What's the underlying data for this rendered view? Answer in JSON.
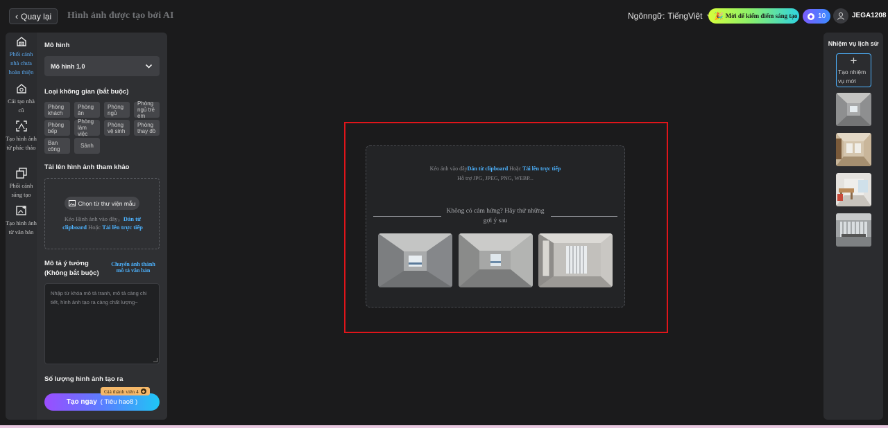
{
  "topbar": {
    "back_label": "Quay lại",
    "app_title": "Hình ảnh được tạo bởi AI",
    "language_label": "Ngônngữ:",
    "language_value": "TiếngViệt",
    "promo_label": "Mời để kiếm điểm sáng tạo",
    "points": "10",
    "username": "JEGA1208"
  },
  "nav": {
    "items": [
      {
        "label": "Phối cảnh nhà chưa hoàn thiện",
        "icon": "house-frame-icon",
        "active": true
      },
      {
        "label": "Cải tạo nhà cũ",
        "icon": "house-renovate-icon",
        "active": false
      },
      {
        "label": "Tạo hình ảnh từ phác thảo",
        "icon": "sketch-to-image-icon",
        "active": false
      },
      {
        "label": "Phối cảnh sáng tạo",
        "icon": "creative-layers-icon",
        "active": false
      },
      {
        "label": "Tạo hình ảnh từ văn bản",
        "icon": "text-to-image-icon",
        "active": false
      }
    ]
  },
  "panel": {
    "model_title": "Mô hình",
    "model_value": "Mô hình 1.0",
    "space_title": "Loại không gian (bắt buộc)",
    "space_types": [
      "Phòng khách",
      "Phòng ăn",
      "Phòng ngủ",
      "Phòng ngủ trẻ em",
      "Phòng bếp",
      "Phòng làm việc",
      "Phòng vệ sinh",
      "Phòng thay đồ",
      "Ban công",
      "Sảnh"
    ],
    "upload_title": "Tải lên hình ảnh tham khảo",
    "library_button": "Chọn từ thư viện mẫu",
    "upload_hint_prefix": "Kéo Hình ảnh vào đây，",
    "upload_hint_clipboard": "Dán từ clipboard",
    "upload_hint_or": " Hoặc ",
    "upload_hint_direct": "Tải lên trực tiếp",
    "desc_title": "Mô tả ý tưởng (Không bắt buộc)",
    "convert_link": "Chuyển ảnh thành mô tả văn bản",
    "desc_placeholder": "Nhập từ khóa mô tả tranh, mô tả càng chi tiết, hình ảnh tạo ra càng chất lượng~",
    "count_title": "Số lượng hình ảnh tạo ra",
    "member_badge": "Giá thành viên 4",
    "generate_label": "Tạo ngay",
    "generate_cost": "( Tiêu hao8 )"
  },
  "dropzone": {
    "hint_prefix": "Kéo ảnh vào đây",
    "hint_clipboard": "Dán từ clipboard",
    "hint_or": " Hoặc ",
    "hint_direct": "Tải lên trực tiếp",
    "formats": "Hỗ trợ JPG, JPEG, PNG, WEBP...",
    "inspiration": "Không có cảm hứng? Hãy thử những gợi ý sau",
    "samples": [
      "sample-room-1",
      "sample-room-2",
      "sample-room-3"
    ]
  },
  "history": {
    "title": "Nhiệm vụ lịch sử",
    "new_task": "Tạo nhiệm vụ mới",
    "thumbnails": [
      "history-1",
      "history-2",
      "history-3",
      "history-4"
    ]
  },
  "colors": {
    "accent": "#4db3ff",
    "highlight_frame": "#e0151a",
    "background": "#1b1b1c"
  }
}
